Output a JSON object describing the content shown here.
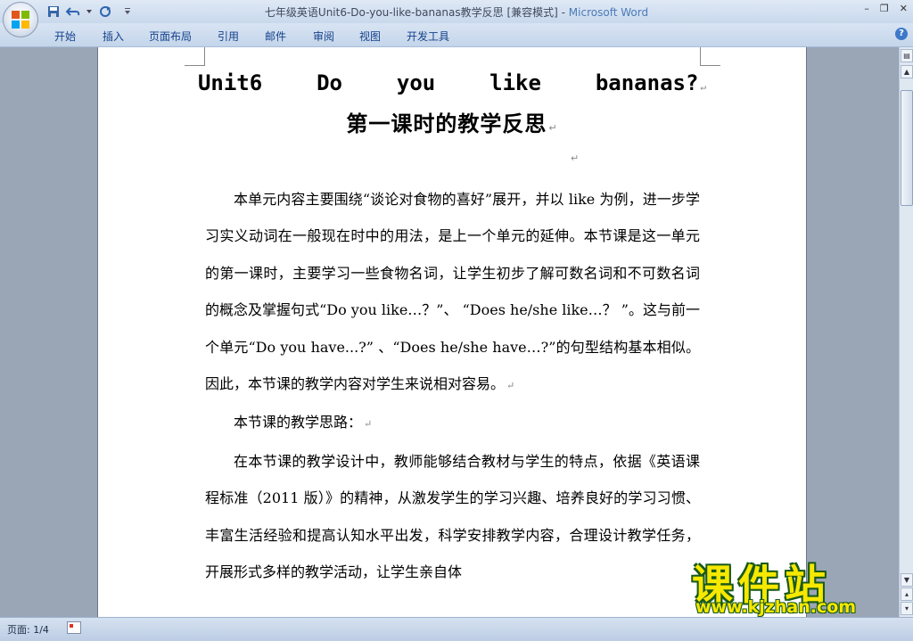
{
  "window": {
    "title_doc": "七年级英语Unit6-Do-you-like-bananas教学反思 [兼容模式] - ",
    "title_app": "Microsoft Word",
    "minimize": "–",
    "restore": "❐",
    "close": "✕"
  },
  "ribbon": {
    "tabs": [
      "开始",
      "插入",
      "页面布局",
      "引用",
      "邮件",
      "审阅",
      "视图",
      "开发工具"
    ],
    "help": "?"
  },
  "document": {
    "heading1": "Unit6  Do  you  like  bananas?",
    "heading2": "第一课时的教学反思",
    "paragraph_mark": "↵",
    "paragraphs": [
      "本单元内容主要围绕“谈论对食物的喜好”展开，并以 like 为例，进一步学习实义动词在一般现在时中的用法，是上一个单元的延伸。本节课是这一单元的第一课时，主要学习一些食物名词，让学生初步了解可数名词和不可数名词的概念及掌握句式“Do you like…？”、 “Does he/she like…？ ”。这与前一个单元“Do  you  have...?” 、“Does he/she have…?”的句型结构基本相似。因此，本节课的教学内容对学生来说相对容易。",
      "本节课的教学思路：",
      "在本节课的教学设计中，教师能够结合教材与学生的特点，依据《英语课程标准（2011 版）》的精神，从激发学生的学习兴趣、培养良好的学习习惯、丰富生活经验和提高认知水平出发，科学安排教学内容，合理设计教学任务，开展形式多样的教学活动，让学生亲自体"
    ]
  },
  "statusbar": {
    "page": "页面: 1/4"
  },
  "watermark": {
    "main": "课件站",
    "url": "www.kjzhan.com"
  },
  "colors": {
    "ribbon_text": "#15428b",
    "app_title": "#4a7ab8",
    "watermark_fill": "#f7e800",
    "watermark_outline": "#1a5a1a"
  }
}
